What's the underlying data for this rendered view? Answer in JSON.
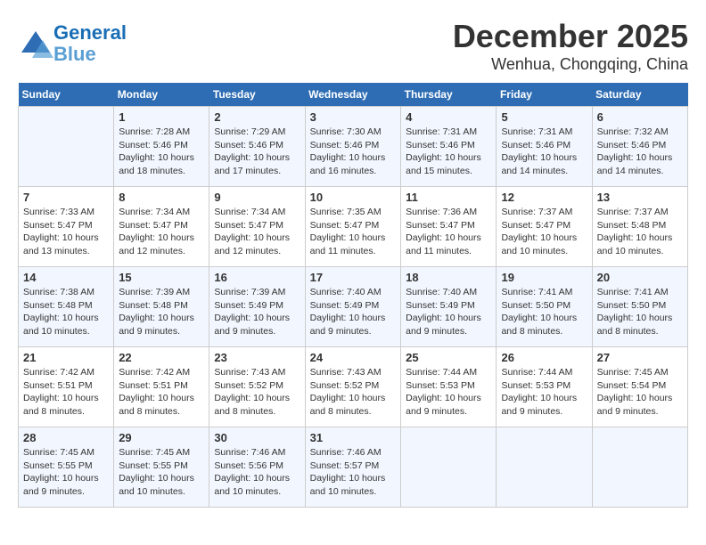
{
  "header": {
    "logo_line1": "General",
    "logo_line2": "Blue",
    "month": "December 2025",
    "location": "Wenhua, Chongqing, China"
  },
  "weekdays": [
    "Sunday",
    "Monday",
    "Tuesday",
    "Wednesday",
    "Thursday",
    "Friday",
    "Saturday"
  ],
  "weeks": [
    [
      {
        "day": "",
        "sunrise": "",
        "sunset": "",
        "daylight": ""
      },
      {
        "day": "1",
        "sunrise": "Sunrise: 7:28 AM",
        "sunset": "Sunset: 5:46 PM",
        "daylight": "Daylight: 10 hours and 18 minutes."
      },
      {
        "day": "2",
        "sunrise": "Sunrise: 7:29 AM",
        "sunset": "Sunset: 5:46 PM",
        "daylight": "Daylight: 10 hours and 17 minutes."
      },
      {
        "day": "3",
        "sunrise": "Sunrise: 7:30 AM",
        "sunset": "Sunset: 5:46 PM",
        "daylight": "Daylight: 10 hours and 16 minutes."
      },
      {
        "day": "4",
        "sunrise": "Sunrise: 7:31 AM",
        "sunset": "Sunset: 5:46 PM",
        "daylight": "Daylight: 10 hours and 15 minutes."
      },
      {
        "day": "5",
        "sunrise": "Sunrise: 7:31 AM",
        "sunset": "Sunset: 5:46 PM",
        "daylight": "Daylight: 10 hours and 14 minutes."
      },
      {
        "day": "6",
        "sunrise": "Sunrise: 7:32 AM",
        "sunset": "Sunset: 5:46 PM",
        "daylight": "Daylight: 10 hours and 14 minutes."
      }
    ],
    [
      {
        "day": "7",
        "sunrise": "Sunrise: 7:33 AM",
        "sunset": "Sunset: 5:47 PM",
        "daylight": "Daylight: 10 hours and 13 minutes."
      },
      {
        "day": "8",
        "sunrise": "Sunrise: 7:34 AM",
        "sunset": "Sunset: 5:47 PM",
        "daylight": "Daylight: 10 hours and 12 minutes."
      },
      {
        "day": "9",
        "sunrise": "Sunrise: 7:34 AM",
        "sunset": "Sunset: 5:47 PM",
        "daylight": "Daylight: 10 hours and 12 minutes."
      },
      {
        "day": "10",
        "sunrise": "Sunrise: 7:35 AM",
        "sunset": "Sunset: 5:47 PM",
        "daylight": "Daylight: 10 hours and 11 minutes."
      },
      {
        "day": "11",
        "sunrise": "Sunrise: 7:36 AM",
        "sunset": "Sunset: 5:47 PM",
        "daylight": "Daylight: 10 hours and 11 minutes."
      },
      {
        "day": "12",
        "sunrise": "Sunrise: 7:37 AM",
        "sunset": "Sunset: 5:47 PM",
        "daylight": "Daylight: 10 hours and 10 minutes."
      },
      {
        "day": "13",
        "sunrise": "Sunrise: 7:37 AM",
        "sunset": "Sunset: 5:48 PM",
        "daylight": "Daylight: 10 hours and 10 minutes."
      }
    ],
    [
      {
        "day": "14",
        "sunrise": "Sunrise: 7:38 AM",
        "sunset": "Sunset: 5:48 PM",
        "daylight": "Daylight: 10 hours and 10 minutes."
      },
      {
        "day": "15",
        "sunrise": "Sunrise: 7:39 AM",
        "sunset": "Sunset: 5:48 PM",
        "daylight": "Daylight: 10 hours and 9 minutes."
      },
      {
        "day": "16",
        "sunrise": "Sunrise: 7:39 AM",
        "sunset": "Sunset: 5:49 PM",
        "daylight": "Daylight: 10 hours and 9 minutes."
      },
      {
        "day": "17",
        "sunrise": "Sunrise: 7:40 AM",
        "sunset": "Sunset: 5:49 PM",
        "daylight": "Daylight: 10 hours and 9 minutes."
      },
      {
        "day": "18",
        "sunrise": "Sunrise: 7:40 AM",
        "sunset": "Sunset: 5:49 PM",
        "daylight": "Daylight: 10 hours and 9 minutes."
      },
      {
        "day": "19",
        "sunrise": "Sunrise: 7:41 AM",
        "sunset": "Sunset: 5:50 PM",
        "daylight": "Daylight: 10 hours and 8 minutes."
      },
      {
        "day": "20",
        "sunrise": "Sunrise: 7:41 AM",
        "sunset": "Sunset: 5:50 PM",
        "daylight": "Daylight: 10 hours and 8 minutes."
      }
    ],
    [
      {
        "day": "21",
        "sunrise": "Sunrise: 7:42 AM",
        "sunset": "Sunset: 5:51 PM",
        "daylight": "Daylight: 10 hours and 8 minutes."
      },
      {
        "day": "22",
        "sunrise": "Sunrise: 7:42 AM",
        "sunset": "Sunset: 5:51 PM",
        "daylight": "Daylight: 10 hours and 8 minutes."
      },
      {
        "day": "23",
        "sunrise": "Sunrise: 7:43 AM",
        "sunset": "Sunset: 5:52 PM",
        "daylight": "Daylight: 10 hours and 8 minutes."
      },
      {
        "day": "24",
        "sunrise": "Sunrise: 7:43 AM",
        "sunset": "Sunset: 5:52 PM",
        "daylight": "Daylight: 10 hours and 8 minutes."
      },
      {
        "day": "25",
        "sunrise": "Sunrise: 7:44 AM",
        "sunset": "Sunset: 5:53 PM",
        "daylight": "Daylight: 10 hours and 9 minutes."
      },
      {
        "day": "26",
        "sunrise": "Sunrise: 7:44 AM",
        "sunset": "Sunset: 5:53 PM",
        "daylight": "Daylight: 10 hours and 9 minutes."
      },
      {
        "day": "27",
        "sunrise": "Sunrise: 7:45 AM",
        "sunset": "Sunset: 5:54 PM",
        "daylight": "Daylight: 10 hours and 9 minutes."
      }
    ],
    [
      {
        "day": "28",
        "sunrise": "Sunrise: 7:45 AM",
        "sunset": "Sunset: 5:55 PM",
        "daylight": "Daylight: 10 hours and 9 minutes."
      },
      {
        "day": "29",
        "sunrise": "Sunrise: 7:45 AM",
        "sunset": "Sunset: 5:55 PM",
        "daylight": "Daylight: 10 hours and 10 minutes."
      },
      {
        "day": "30",
        "sunrise": "Sunrise: 7:46 AM",
        "sunset": "Sunset: 5:56 PM",
        "daylight": "Daylight: 10 hours and 10 minutes."
      },
      {
        "day": "31",
        "sunrise": "Sunrise: 7:46 AM",
        "sunset": "Sunset: 5:57 PM",
        "daylight": "Daylight: 10 hours and 10 minutes."
      },
      {
        "day": "",
        "sunrise": "",
        "sunset": "",
        "daylight": ""
      },
      {
        "day": "",
        "sunrise": "",
        "sunset": "",
        "daylight": ""
      },
      {
        "day": "",
        "sunrise": "",
        "sunset": "",
        "daylight": ""
      }
    ]
  ]
}
